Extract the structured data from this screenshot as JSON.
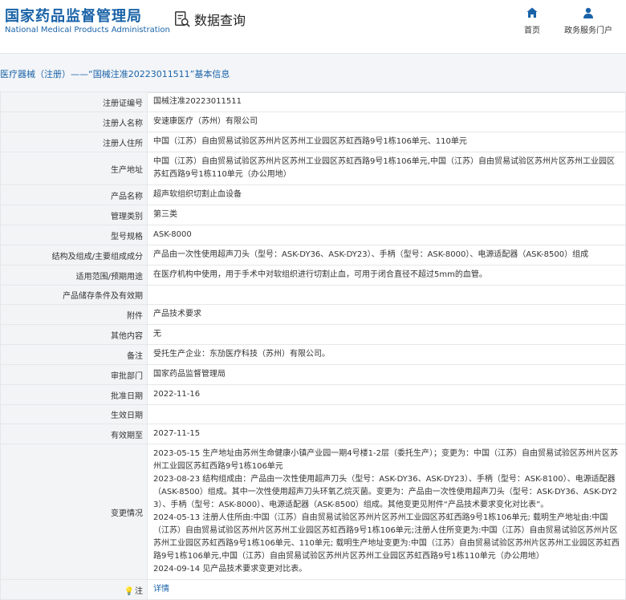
{
  "header": {
    "logo_cn": "国家药品监督管理局",
    "logo_en": "National Medical Products Administration",
    "search_label": "数据查询",
    "nav": [
      {
        "label": "首页",
        "icon": "home-icon"
      },
      {
        "label": "政务服务门户",
        "icon": "user-icon"
      }
    ]
  },
  "breadcrumb": "医疗器械（注册）——“国械注准20223011511”基本信息",
  "details": [
    {
      "label": "注册证编号",
      "value": "国械注准20223011511"
    },
    {
      "label": "注册人名称",
      "value": "安速康医疗（苏州）有限公司"
    },
    {
      "label": "注册人住所",
      "value": "中国（江苏）自由贸易试验区苏州片区苏州工业园区苏虹西路9号1栋106单元、110单元"
    },
    {
      "label": "生产地址",
      "value": "中国（江苏）自由贸易试验区苏州片区苏州工业园区苏虹西路9号1栋106单元,中国（江苏）自由贸易试验区苏州片区苏州工业园区苏虹西路9号1栋110单元（办公用地）"
    },
    {
      "label": "产品名称",
      "value": "超声软组织切割止血设备"
    },
    {
      "label": "管理类别",
      "value": "第三类"
    },
    {
      "label": "型号规格",
      "value": "ASK-8000"
    },
    {
      "label": "结构及组成/主要组成成分",
      "value": "产品由一次性使用超声刀头（型号：ASK-DY36、ASK-DY23）、手柄（型号：ASK-8000）、电源适配器（ASK-8500）组成"
    },
    {
      "label": "适用范围/预期用途",
      "value": "在医疗机构中使用，用于手术中对软组织进行切割止血，可用于闭合直径不超过5mm的血管。"
    },
    {
      "label": "产品储存条件及有效期",
      "value": ""
    },
    {
      "label": "附件",
      "value": "产品技术要求"
    },
    {
      "label": "其他内容",
      "value": "无"
    },
    {
      "label": "备注",
      "value": "受托生产企业：东劢医疗科技（苏州）有限公司。"
    },
    {
      "label": "审批部门",
      "value": "国家药品监督管理局"
    },
    {
      "label": "批准日期",
      "value": "2022-11-16"
    },
    {
      "label": "生效日期",
      "value": ""
    },
    {
      "label": "有效期至",
      "value": "2027-11-15"
    }
  ],
  "changes": {
    "label": "变更情况",
    "lines": [
      "2023-05-15 生产地址由苏州生命健康小镇产业园一期4号楼1-2层（委托生产）；变更为：中国（江苏）自由贸易试验区苏州片区苏州工业园区苏虹西路9号1栋106单元",
      "2023-08-23 结构组成由：产品由一次性使用超声刀头（型号：ASK-DY36、ASK-DY23）、手柄（型号：ASK-8100）、电源适配器（ASK-8500）组成。其中一次性使用超声刀头环氧乙烷灭菌。变更为：产品由一次性使用超声刀头（型号：ASK-DY36、ASK-DY23）、手柄（型号：ASK-8000）、电源适配器（ASK-8500）组成。其他变更见附件“产品技术要求变化对比表”。",
      "2024-05-13 注册人住所由:中国（江苏）自由贸易试验区苏州片区苏州工业园区苏虹西路9号1栋106单元; 载明生产地址由:中国（江苏）自由贸易试验区苏州片区苏州工业园区苏虹西路9号1栋106单元;注册人住所变更为:中国（江苏）自由贸易试验区苏州片区苏州工业园区苏虹西路9号1栋106单元、110单元; 载明生产地址变更为:中国（江苏）自由贸易试验区苏州片区苏州工业园区苏虹西路9号1栋106单元,中国（江苏）自由贸易试验区苏州片区苏州工业园区苏虹西路9号1栋110单元（办公用地）",
      "2024-09-14 见产品技术要求变更对比表。"
    ]
  },
  "note": {
    "label": "注",
    "icon": "lightbulb-icon",
    "link": "详情"
  }
}
